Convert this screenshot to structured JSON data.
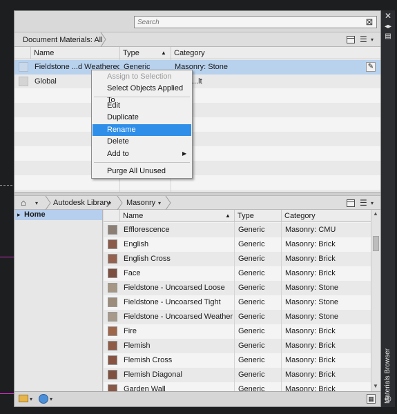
{
  "search": {
    "placeholder": "Search"
  },
  "document_section": {
    "breadcrumb": "Document Materials: All",
    "columns": [
      "Name",
      "Type",
      "Category"
    ],
    "rows": [
      {
        "name": "Fieldstone ...d Weathered",
        "type": "Generic",
        "category": "Masonry: Stone",
        "selected": true
      },
      {
        "name": "Global",
        "type": "",
        "category": "...lt",
        "selected": false
      }
    ]
  },
  "context_menu": {
    "items": [
      {
        "label": "Assign to Selection",
        "state": "disabled"
      },
      {
        "label": "Select Objects Applied To",
        "state": "normal"
      },
      {
        "label": "Edit",
        "state": "normal"
      },
      {
        "label": "Duplicate",
        "state": "normal"
      },
      {
        "label": "Rename",
        "state": "highlighted"
      },
      {
        "label": "Delete",
        "state": "normal"
      },
      {
        "label": "Add to",
        "state": "submenu"
      },
      {
        "label": "Purge All Unused",
        "state": "normal"
      }
    ]
  },
  "library_section": {
    "breadcrumb": [
      "Autodesk Library",
      "Masonry"
    ],
    "tree_selected": "Home",
    "columns": [
      "Name",
      "Type",
      "Category"
    ],
    "rows": [
      {
        "name": "Efflorescence",
        "type": "Generic",
        "category": "Masonry: CMU",
        "swatch": "#8b7e74"
      },
      {
        "name": "English",
        "type": "Generic",
        "category": "Masonry: Brick",
        "swatch": "#8a5a4a"
      },
      {
        "name": "English Cross",
        "type": "Generic",
        "category": "Masonry: Brick",
        "swatch": "#94624f"
      },
      {
        "name": "Face",
        "type": "Generic",
        "category": "Masonry: Brick",
        "swatch": "#7d4f40"
      },
      {
        "name": "Fieldstone - Uncoarsed Loose",
        "type": "Generic",
        "category": "Masonry: Stone",
        "swatch": "#a69684"
      },
      {
        "name": "Fieldstone - Uncoarsed Tight",
        "type": "Generic",
        "category": "Masonry: Stone",
        "swatch": "#9b8c7c"
      },
      {
        "name": "Fieldstone - Uncoarsed Weathered",
        "type": "Generic",
        "category": "Masonry: Stone",
        "swatch": "#a89a8a"
      },
      {
        "name": "Fire",
        "type": "Generic",
        "category": "Masonry: Brick",
        "swatch": "#a0664a"
      },
      {
        "name": "Flemish",
        "type": "Generic",
        "category": "Masonry: Brick",
        "swatch": "#8e5b47"
      },
      {
        "name": "Flemish Cross",
        "type": "Generic",
        "category": "Masonry: Brick",
        "swatch": "#875443"
      },
      {
        "name": "Flemish Diagonal",
        "type": "Generic",
        "category": "Masonry: Brick",
        "swatch": "#7f5040"
      },
      {
        "name": "Garden Wall",
        "type": "Generic",
        "category": "Masonry: Brick",
        "swatch": "#8a5846"
      }
    ]
  },
  "palette_title": "Materials Browser",
  "colors": {
    "selection": "#b8d2ee",
    "menu_highlight": "#2f8fe8",
    "tree_selected": "#b7cfee"
  }
}
